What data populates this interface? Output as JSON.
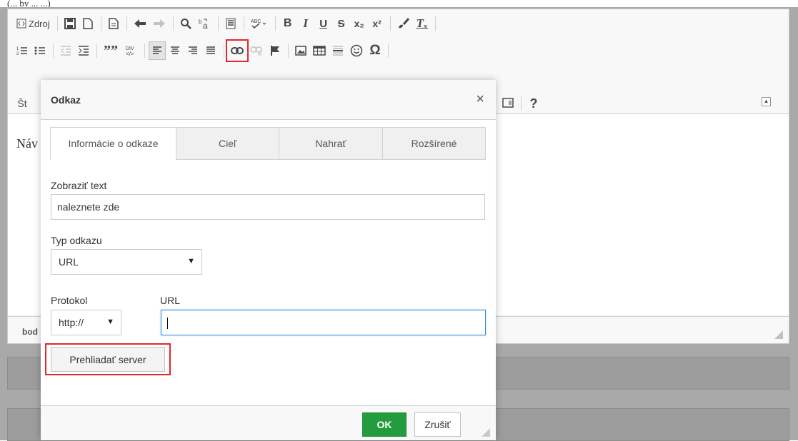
{
  "top_crop_text": "(... by ... ...)",
  "toolbar": {
    "row1": {
      "source_label": "Zdroj",
      "bold": "B",
      "italic": "I",
      "underline": "U",
      "strike": "S",
      "subscript": "x₂",
      "superscript": "x²",
      "remove_format": "Tₓ"
    },
    "row3": {
      "styles_prefix": "Št",
      "help": "?"
    }
  },
  "editor": {
    "content_prefix": "Náv",
    "status_path": "bod"
  },
  "dialog": {
    "title": "Odkaz",
    "close": "×",
    "tabs": [
      {
        "label": "Informácie o odkaze",
        "active": true
      },
      {
        "label": "Cieľ",
        "active": false
      },
      {
        "label": "Nahrať",
        "active": false
      },
      {
        "label": "Rozšírené",
        "active": false
      }
    ],
    "display_text_label": "Zobraziť text",
    "display_text_value": "naleznete zde",
    "link_type_label": "Typ odkazu",
    "link_type_value": "URL",
    "protocol_label": "Protokol",
    "protocol_value": "http://",
    "url_label": "URL",
    "url_value": "",
    "browse_button": "Prehliadať server",
    "ok_button": "OK",
    "cancel_button": "Zrušiť"
  },
  "colors": {
    "highlight": "#e0282f",
    "ok_green": "#229c3e",
    "focus_blue": "#3b8fd5"
  }
}
